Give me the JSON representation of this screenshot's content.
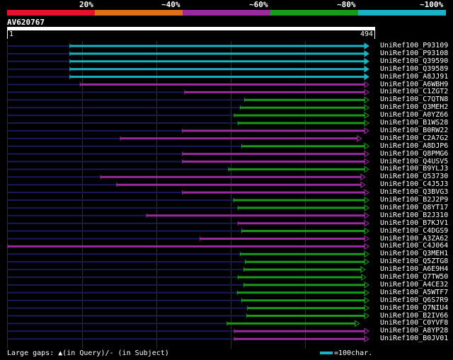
{
  "legend": {
    "labels": [
      "20%",
      "~40%",
      "~60%",
      "~80%",
      "~100%"
    ],
    "colors": [
      "#e8102a",
      "#e07018",
      "#9a2aa0",
      "#1a9a1a",
      "#18b4c4"
    ]
  },
  "query": {
    "id": "AV620767",
    "start": "1",
    "end": "494"
  },
  "hits": [
    {
      "id": "UniRef100_P93109",
      "start": 86,
      "end": 494,
      "pct": "~100%"
    },
    {
      "id": "UniRef100_P93108",
      "start": 86,
      "end": 494,
      "pct": "~100%"
    },
    {
      "id": "UniRef100_Q39590",
      "start": 86,
      "end": 494,
      "pct": "~100%"
    },
    {
      "id": "UniRef100_Q39589",
      "start": 86,
      "end": 494,
      "pct": "~100%"
    },
    {
      "id": "UniRef100_A8JJ91",
      "start": 86,
      "end": 494,
      "pct": "~100%"
    },
    {
      "id": "UniRef100_A6WBH9",
      "start": 100,
      "end": 494,
      "pct": "~60%"
    },
    {
      "id": "UniRef100_C1ZGT2",
      "start": 243,
      "end": 494,
      "pct": "~60%"
    },
    {
      "id": "UniRef100_C7QTN8",
      "start": 325,
      "end": 494,
      "pct": "~80%"
    },
    {
      "id": "UniRef100_Q3MEH2",
      "start": 319,
      "end": 494,
      "pct": "~80%"
    },
    {
      "id": "UniRef100_A0YZ66",
      "start": 311,
      "end": 494,
      "pct": "~80%"
    },
    {
      "id": "UniRef100_B1WS28",
      "start": 316,
      "end": 494,
      "pct": "~80%"
    },
    {
      "id": "UniRef100_B0RW22",
      "start": 240,
      "end": 494,
      "pct": "~60%"
    },
    {
      "id": "UniRef100_C2A7G2",
      "start": 155,
      "end": 484,
      "pct": "~60%"
    },
    {
      "id": "UniRef100_A8DJP6",
      "start": 321,
      "end": 494,
      "pct": "~80%"
    },
    {
      "id": "UniRef100_Q8PMG6",
      "start": 240,
      "end": 494,
      "pct": "~60%"
    },
    {
      "id": "UniRef100_Q4USV5",
      "start": 240,
      "end": 494,
      "pct": "~60%"
    },
    {
      "id": "UniRef100_B9YLJ3",
      "start": 303,
      "end": 494,
      "pct": "~80%"
    },
    {
      "id": "UniRef100_Q53730",
      "start": 128,
      "end": 489,
      "pct": "~60%"
    },
    {
      "id": "UniRef100_C4J5J3",
      "start": 150,
      "end": 489,
      "pct": "~60%"
    },
    {
      "id": "UniRef100_Q3BVG3",
      "start": 240,
      "end": 494,
      "pct": "~60%"
    },
    {
      "id": "UniRef100_B2J2P9",
      "start": 310,
      "end": 494,
      "pct": "~80%"
    },
    {
      "id": "UniRef100_Q8YT17",
      "start": 316,
      "end": 494,
      "pct": "~80%"
    },
    {
      "id": "UniRef100_B2J310",
      "start": 191,
      "end": 494,
      "pct": "~60%"
    },
    {
      "id": "UniRef100_B7KJV1",
      "start": 316,
      "end": 494,
      "pct": "~60%"
    },
    {
      "id": "UniRef100_C4DGS9",
      "start": 321,
      "end": 494,
      "pct": "~80%"
    },
    {
      "id": "UniRef100_A3ZA62",
      "start": 264,
      "end": 494,
      "pct": "~60%"
    },
    {
      "id": "UniRef100_C4J064",
      "start": 1,
      "end": 494,
      "pct": "~60%"
    },
    {
      "id": "UniRef100_Q3MEH1",
      "start": 319,
      "end": 494,
      "pct": "~80%"
    },
    {
      "id": "UniRef100_Q5ZTG8",
      "start": 326,
      "end": 494,
      "pct": "~80%"
    },
    {
      "id": "UniRef100_A6E9H4",
      "start": 324,
      "end": 489,
      "pct": "~80%"
    },
    {
      "id": "UniRef100_Q7TW50",
      "start": 316,
      "end": 490,
      "pct": "~80%"
    },
    {
      "id": "UniRef100_A4CE32",
      "start": 324,
      "end": 494,
      "pct": "~80%"
    },
    {
      "id": "UniRef100_A5WTF7",
      "start": 315,
      "end": 494,
      "pct": "~80%"
    },
    {
      "id": "UniRef100_Q6S7R9",
      "start": 321,
      "end": 494,
      "pct": "~80%"
    },
    {
      "id": "UniRef100_Q7NIU4",
      "start": 329,
      "end": 494,
      "pct": "~80%"
    },
    {
      "id": "UniRef100_B2IV66",
      "start": 328,
      "end": 494,
      "pct": "~80%"
    },
    {
      "id": "UniRef100_C0YVF8",
      "start": 301,
      "end": 481,
      "pct": "~80%"
    },
    {
      "id": "UniRef100_A8YP28",
      "start": 311,
      "end": 494,
      "pct": "~60%"
    },
    {
      "id": "UniRef100_B0JV01",
      "start": 311,
      "end": 494,
      "pct": "~60%"
    }
  ],
  "footer": {
    "gaps_text": "Large gaps: ▲(in Query)/- (in Subject)",
    "scale_text": "=100char."
  }
}
